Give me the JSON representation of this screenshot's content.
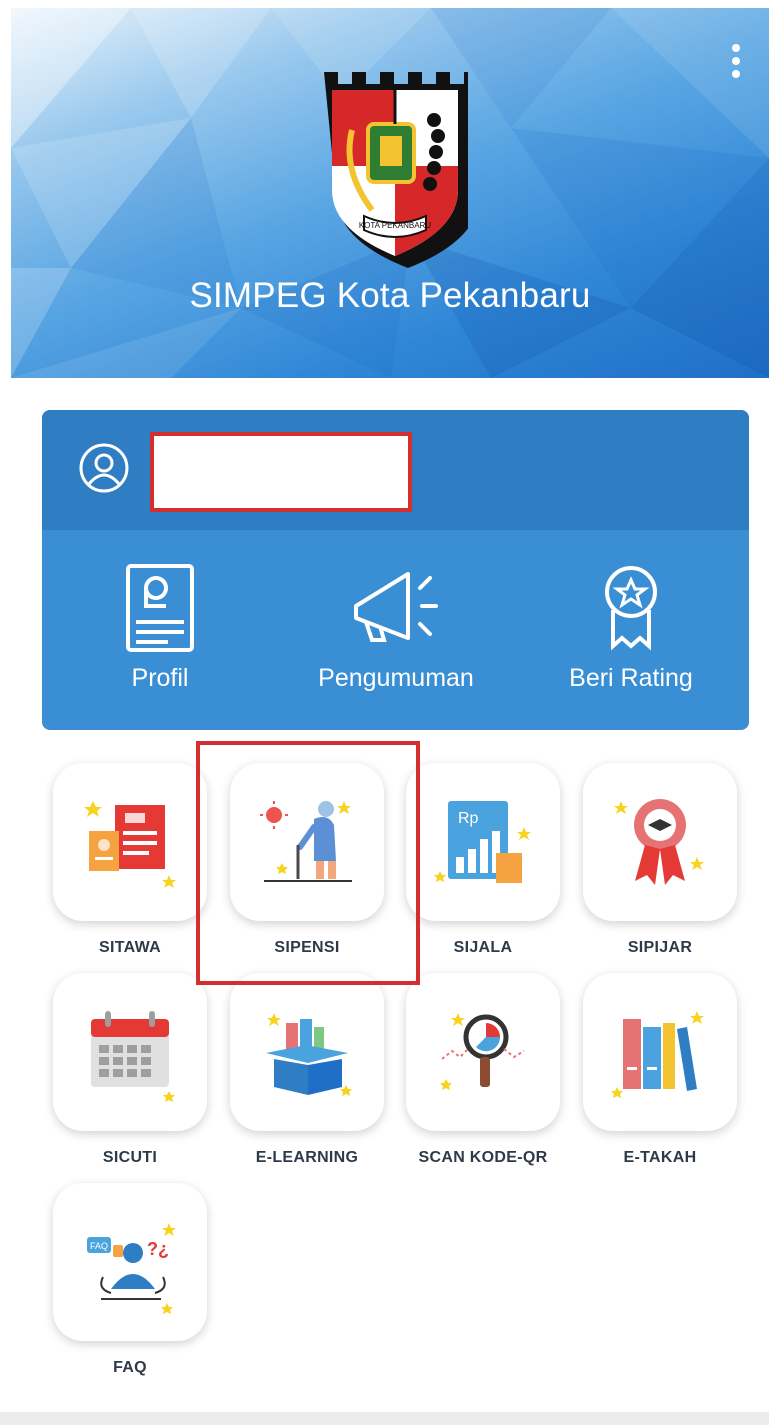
{
  "header": {
    "app_title": "SIMPEG Kota Pekanbaru",
    "logo_text": "KOTA PEKANBARU",
    "menu_icon": "more-vertical-icon"
  },
  "user_card": {
    "avatar_icon": "user-circle-icon",
    "name": "",
    "quick_actions": [
      {
        "label": "Profil",
        "icon": "profile-id-icon"
      },
      {
        "label": "Pengumuman",
        "icon": "megaphone-icon"
      },
      {
        "label": "Beri Rating",
        "icon": "award-badge-icon"
      }
    ]
  },
  "menu": {
    "items": [
      {
        "label": "SITAWA",
        "icon": "documents-icon"
      },
      {
        "label": "SIPENSI",
        "icon": "elderly-person-icon"
      },
      {
        "label": "SIJALA",
        "icon": "salary-chart-icon"
      },
      {
        "label": "SIPIJAR",
        "icon": "graduation-ribbon-icon"
      },
      {
        "label": "SICUTI",
        "icon": "calendar-icon"
      },
      {
        "label": "E-LEARNING",
        "icon": "books-box-icon"
      },
      {
        "label": "SCAN KODE-QR",
        "icon": "magnifier-chart-icon"
      },
      {
        "label": "E-TAKAH",
        "icon": "binders-icon"
      },
      {
        "label": "FAQ",
        "icon": "faq-person-icon",
        "bubble_text": "FAQ",
        "question_marks": "?¿"
      }
    ]
  },
  "colors": {
    "header_blue": "#2f86d6",
    "card_blue": "#3a8fd4",
    "card_top_blue": "#2f7ec3",
    "highlight_red": "#d32f2f"
  }
}
